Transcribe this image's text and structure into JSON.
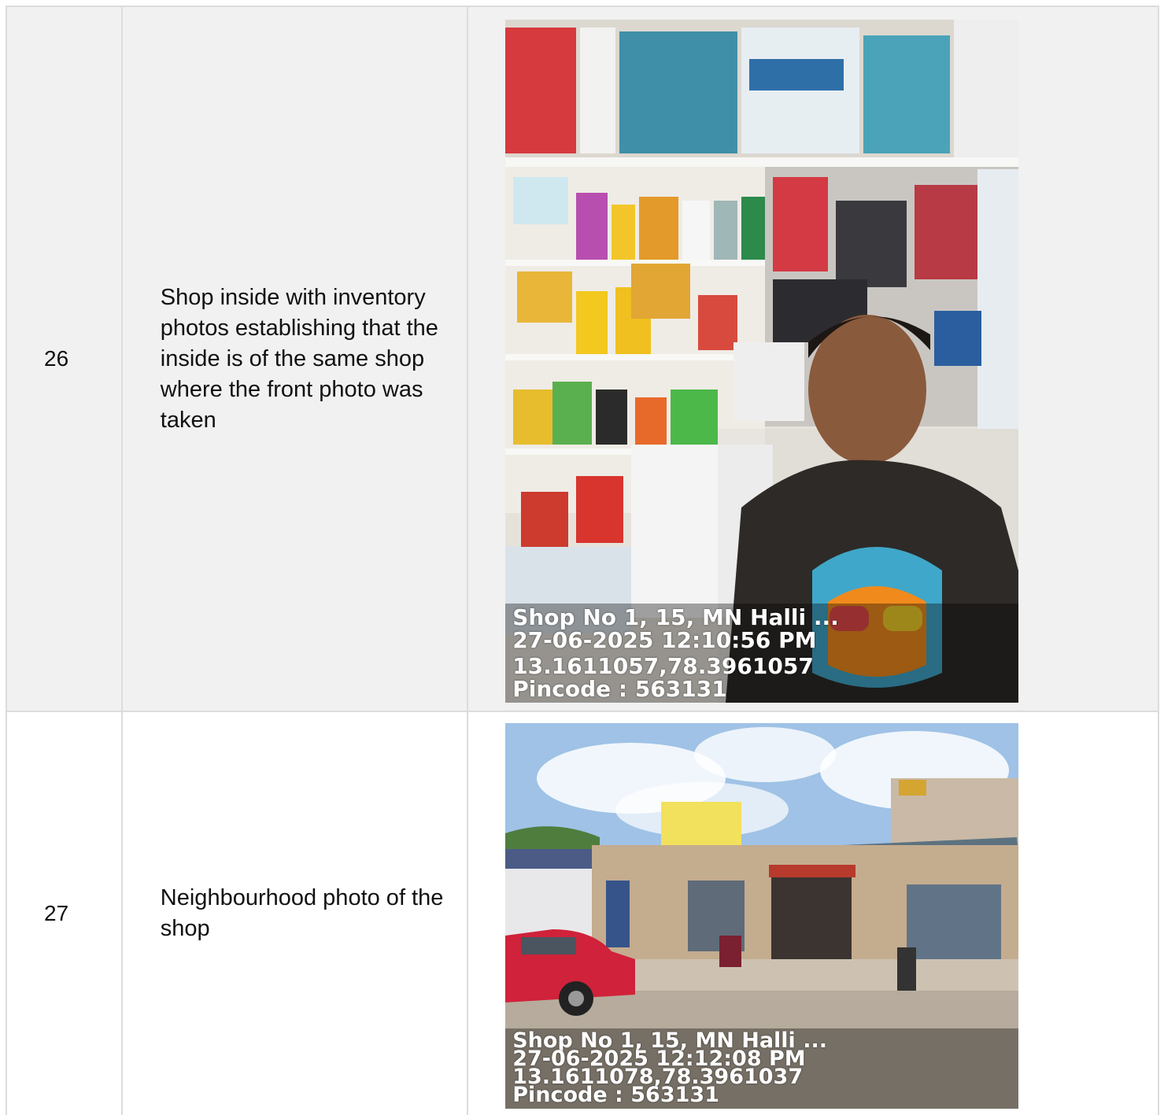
{
  "rows": [
    {
      "number": "26",
      "description": "Shop inside with inventory photos establishing that the inside is of the same shop where the front photo was taken",
      "photo": {
        "subject": "interior-shelves-with-man",
        "stamp": {
          "address": "Shop No 1, 15, MN Halli ...",
          "datetime": "27-06-2025 12:10:56 PM",
          "coords": "13.1611057,78.3961057",
          "pincode": "Pincode : 563131"
        }
      }
    },
    {
      "number": "27",
      "description": "Neighbourhood photo of the shop",
      "photo": {
        "subject": "street-view-shop-front",
        "stamp": {
          "address": "Shop No 1, 15, MN Halli ...",
          "datetime": "27-06-2025 12:12:08 PM",
          "coords": "13.1611078,78.3961037",
          "pincode": "Pincode : 563131"
        }
      }
    }
  ],
  "colors": {
    "border": "#dcdcdc",
    "row_shade": "#f1f1f1"
  }
}
